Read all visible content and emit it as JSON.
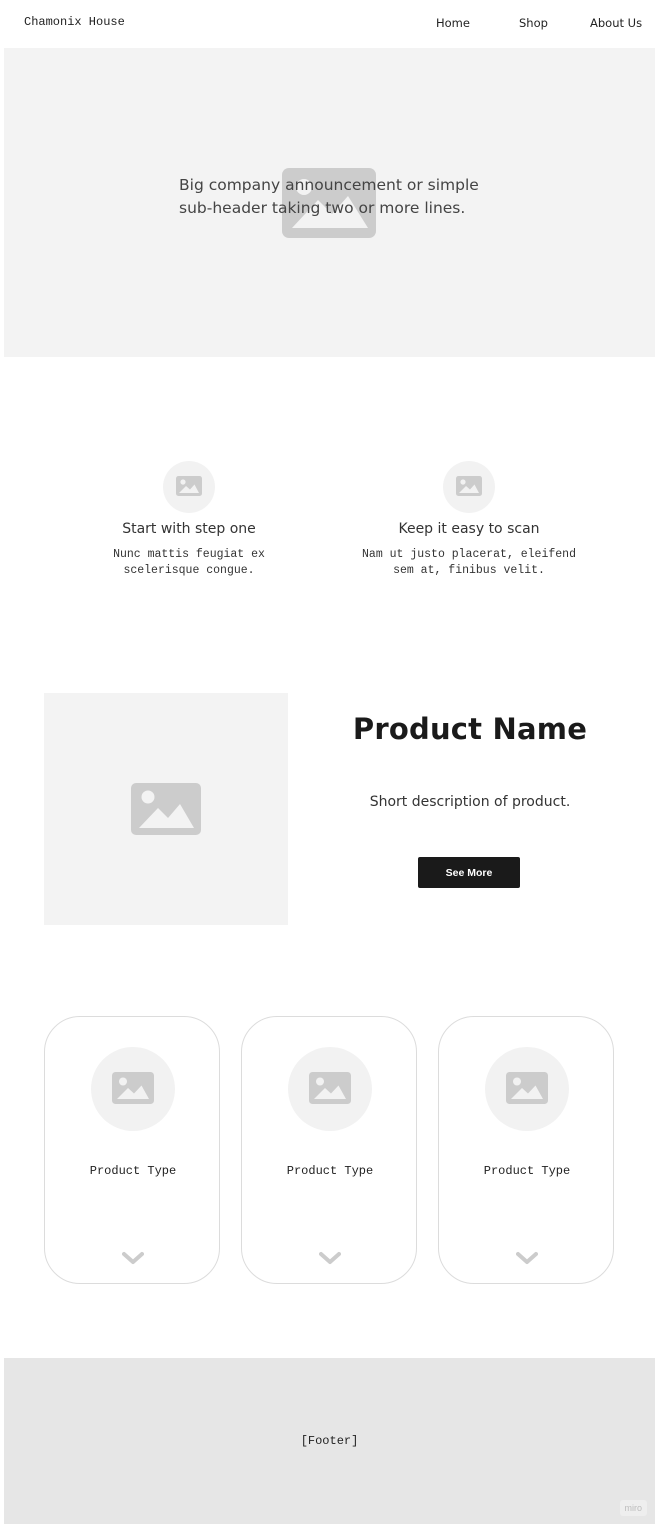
{
  "nav": {
    "brand": "Chamonix House",
    "links": [
      "Home",
      "Shop",
      "About Us"
    ]
  },
  "hero": {
    "line1": "Big company announcement or simple",
    "line2": "sub-header taking two or more lines.",
    "icon": "image-placeholder-icon"
  },
  "steps": [
    {
      "title": "Start with step one",
      "line1": "Nunc mattis feugiat ex",
      "line2": "scelerisque congue.",
      "icon": "image-placeholder-icon"
    },
    {
      "title": "Keep it easy to scan",
      "line1": "Nam ut justo placerat, eleifend",
      "line2": "sem at, finibus velit.",
      "icon": "image-placeholder-icon"
    }
  ],
  "product": {
    "name": "Product Name",
    "description": "Short description of product.",
    "button": "See More"
  },
  "cards": [
    {
      "label": "Product Type",
      "icon": "image-placeholder-icon",
      "chevron": "chevron-down-icon"
    },
    {
      "label": "Product Type",
      "icon": "image-placeholder-icon",
      "chevron": "chevron-down-icon"
    },
    {
      "label": "Product Type",
      "icon": "image-placeholder-icon",
      "chevron": "chevron-down-icon"
    }
  ],
  "footer": {
    "label": "[Footer]",
    "badge": "miro"
  },
  "colors": {
    "placeholder_bg": "#f3f3f3",
    "icon_gray": "#cccccc",
    "button_bg": "#1a1a1a",
    "footer_bg": "#e6e6e6"
  }
}
